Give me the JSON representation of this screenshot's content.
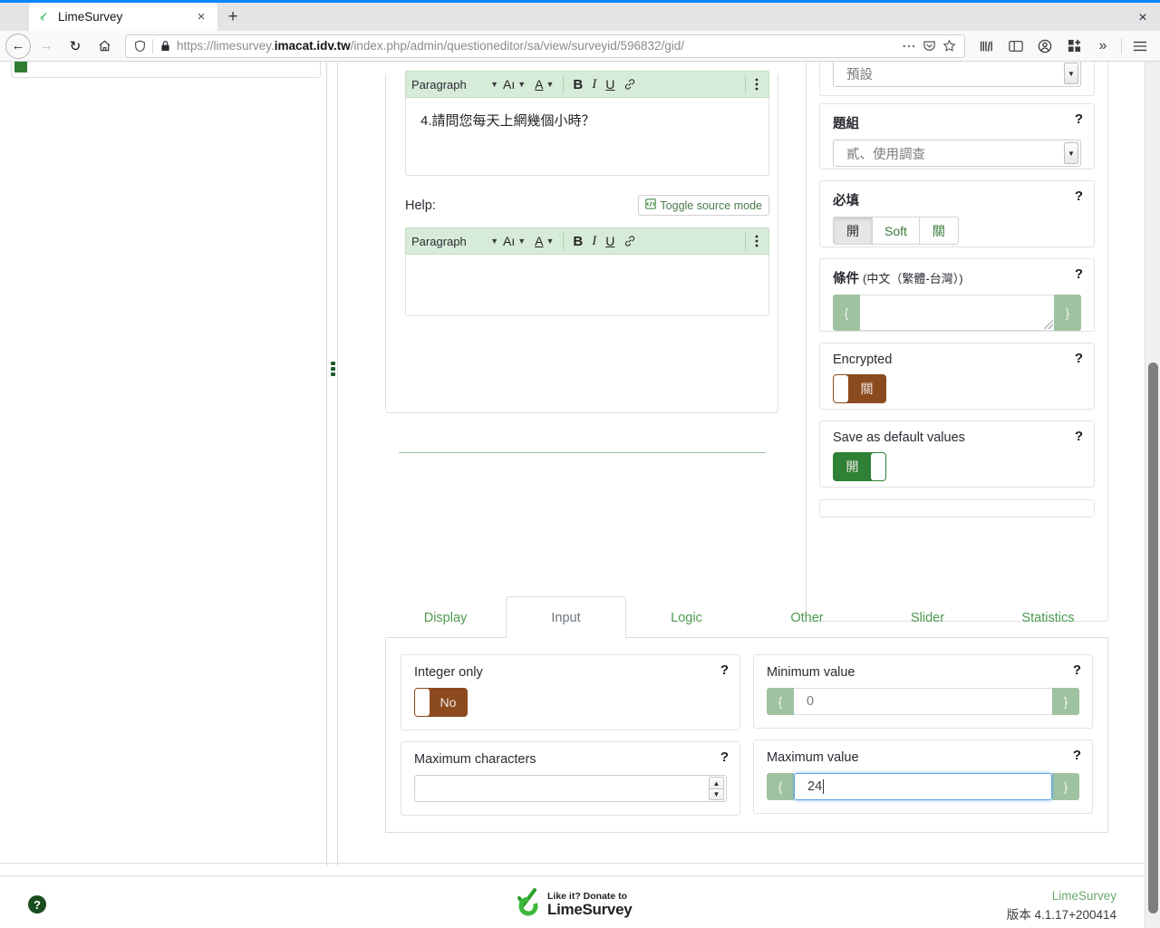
{
  "browser": {
    "tab": {
      "title": "LimeSurvey",
      "favicon_icon": "limesurvey-favicon",
      "close_icon": "close-icon"
    },
    "new_tab_label": "+",
    "window_close_label": "×",
    "nav": {
      "back_icon": "back-arrow-icon",
      "forward_icon": "forward-arrow-icon",
      "reload_icon": "reload-icon",
      "home_icon": "home-icon"
    },
    "urlbar": {
      "shield_icon": "tracking-protection-shield-icon",
      "lock_icon": "padlock-icon",
      "url_prefix": "https://limesurvey.",
      "url_host": "imacat.idv.tw",
      "url_path": "/index.php/admin/questioneditor/sa/view/surveyid/596832/gid/",
      "page_actions_icon": "ellipsis-icon",
      "pocket_icon": "pocket-icon",
      "bookmark_icon": "star-icon"
    },
    "toolbar_icons": [
      "library-icon",
      "sidebar-icon",
      "account-icon",
      "extensions-icon",
      "overflow-chevrons-icon",
      "hamburger-menu-icon"
    ]
  },
  "editor": {
    "question": {
      "toolbar": {
        "paragraph_label": "Paragraph",
        "paragraph_chevron_icon": "chevron-down-icon",
        "font_size_label": "Aı",
        "font_size_chevron_icon": "chevron-down-icon",
        "font_color_label": "A",
        "font_color_chevron_icon": "chevron-down-icon",
        "bold_label": "B",
        "italic_label": "I",
        "underline_label": "U",
        "link_icon": "link-icon",
        "more_icon": "vertical-ellipsis-icon"
      },
      "text": "4.請問您每天上網幾個小時？"
    },
    "help": {
      "label": "Help:",
      "toggle_source_label": "Toggle source mode",
      "toggle_source_icon": "source-code-icon",
      "text": ""
    }
  },
  "sidebar": {
    "default_select": {
      "value": "預設",
      "arrow_icon": "select-arrow-icon"
    },
    "group": {
      "title": "題組",
      "help_icon": "help-question-icon",
      "value": "貳、使用調查",
      "arrow_icon": "select-arrow-icon"
    },
    "mandatory": {
      "title": "必填",
      "help_icon": "help-question-icon",
      "options": [
        "開",
        "Soft",
        "關"
      ],
      "selected_index": 0
    },
    "condition": {
      "title": "條件",
      "title_sub": "(中文（繁體-台灣）)",
      "help_icon": "help-question-icon",
      "left_brace": "{",
      "right_brace": "}",
      "value": ""
    },
    "encrypted": {
      "title": "Encrypted",
      "help_icon": "help-question-icon",
      "state": "off",
      "state_label": "關"
    },
    "save_default": {
      "title": "Save as default values",
      "help_icon": "help-question-icon",
      "state": "on",
      "state_label": "開"
    }
  },
  "settings_tabs": {
    "tabs": [
      {
        "label": "Display",
        "active": false
      },
      {
        "label": "Input",
        "active": true
      },
      {
        "label": "Logic",
        "active": false
      },
      {
        "label": "Other",
        "active": false
      },
      {
        "label": "Slider",
        "active": false
      },
      {
        "label": "Statistics",
        "active": false
      }
    ],
    "fields": {
      "integer_only": {
        "label": "Integer only",
        "help_icon": "help-question-icon",
        "state": "off",
        "state_label": "No"
      },
      "maximum_characters": {
        "label": "Maximum characters",
        "help_icon": "help-question-icon",
        "value": "",
        "spin_up_icon": "chevron-up-icon",
        "spin_down_icon": "chevron-down-icon"
      },
      "minimum_value": {
        "label": "Minimum value",
        "help_icon": "help-question-icon",
        "left_brace": "{",
        "right_brace": "}",
        "value": "0",
        "focused": false
      },
      "maximum_value": {
        "label": "Maximum value",
        "help_icon": "help-question-icon",
        "left_brace": "{",
        "right_brace": "}",
        "value": "24",
        "focused": true
      }
    }
  },
  "footer": {
    "help_icon": "help-circle-icon",
    "donate": {
      "line1": "Like it? Donate to",
      "line2": "LimeSurvey",
      "logo_icon": "limesurvey-logo-icon"
    },
    "product_name": "LimeSurvey",
    "version": "版本 4.1.17+200414"
  },
  "colors": {
    "brand_green": "#2e7d32",
    "link_green": "#4c9a4e",
    "toolbar_green": "#d7ecd8",
    "expr_addon_green": "#9fc3a0",
    "toggle_off_brown": "#8c4a1f",
    "toggle_on_green": "#2f8136",
    "focus_blue": "#5aa0e8",
    "firefox_tab_accent": "#0a84ff"
  }
}
